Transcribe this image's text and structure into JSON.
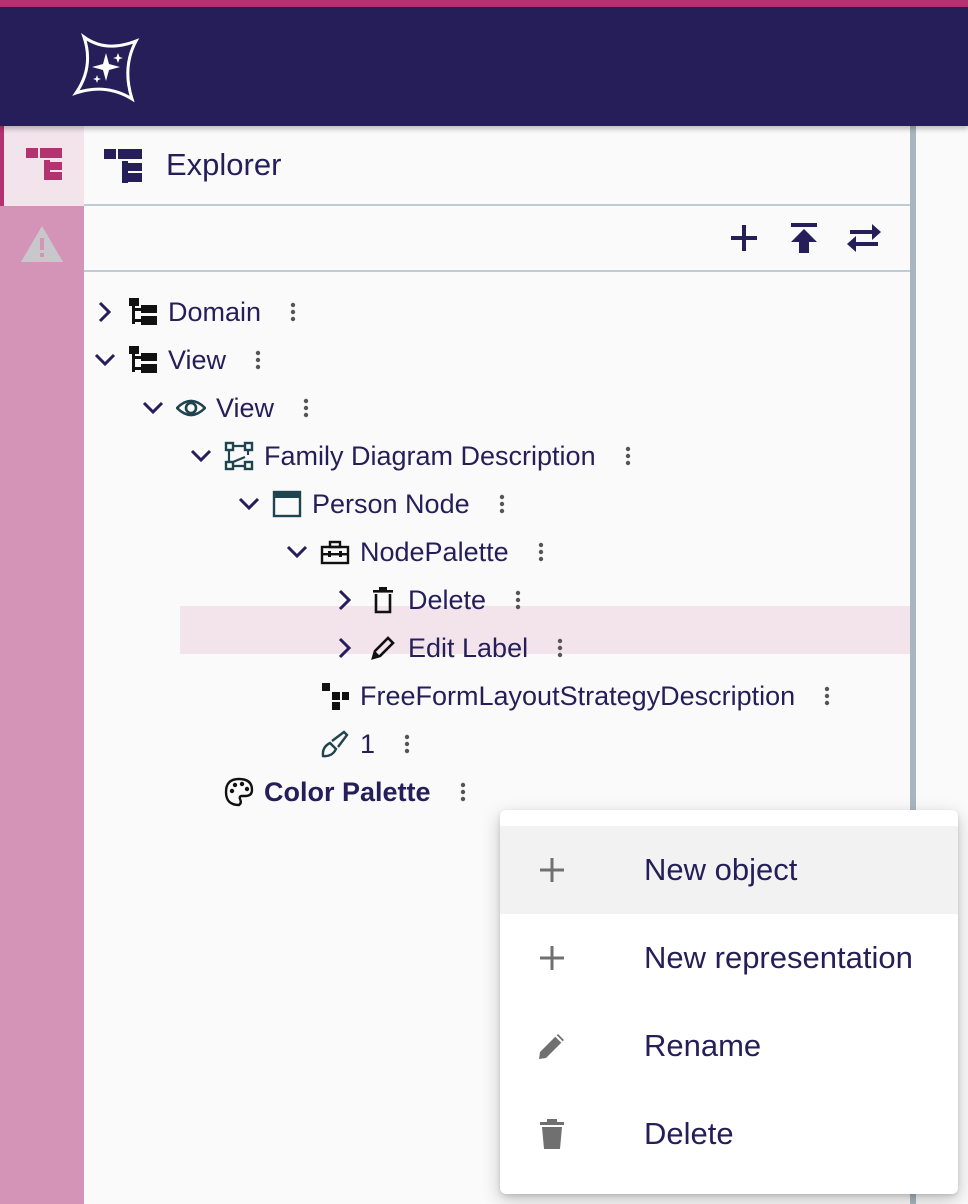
{
  "app": {
    "accent": "#b4326f",
    "header_bg": "#261e58",
    "rail_bg": "#d394b7",
    "logo_icon": "sirius-star-logo"
  },
  "rail": {
    "items": [
      {
        "icon": "explorer-tree-icon",
        "active": true
      },
      {
        "icon": "warning-icon",
        "active": false
      }
    ]
  },
  "explorer": {
    "title": "Explorer",
    "toolbar": [
      {
        "icon": "plus-icon"
      },
      {
        "icon": "upload-icon"
      },
      {
        "icon": "swap-arrows-icon"
      }
    ],
    "tree": [
      {
        "label": "Domain",
        "icon": "tree-icon",
        "expanded": false
      },
      {
        "label": "View",
        "icon": "tree-icon",
        "expanded": true
      },
      {
        "label": "View",
        "icon": "eye-icon",
        "expanded": true
      },
      {
        "label": "Family Diagram Description",
        "icon": "diagram-nodes-icon",
        "expanded": true
      },
      {
        "label": "Person Node",
        "icon": "node-box-icon",
        "expanded": true
      },
      {
        "label": "NodePalette",
        "icon": "toolbox-icon",
        "expanded": true
      },
      {
        "label": "Delete",
        "icon": "trash-outline-icon",
        "expanded": false
      },
      {
        "label": "Edit Label",
        "icon": "pencil-icon",
        "expanded": false
      },
      {
        "label": "FreeFormLayoutStrategyDescription",
        "icon": "layout-squares-icon",
        "expanded": null
      },
      {
        "label": "1",
        "icon": "brush-icon",
        "expanded": null
      },
      {
        "label": "Color Palette",
        "icon": "palette-icon",
        "expanded": null,
        "selected": true
      }
    ]
  },
  "context_menu": {
    "items": [
      {
        "label": "New object",
        "icon": "plus-icon"
      },
      {
        "label": "New representation",
        "icon": "plus-icon"
      },
      {
        "label": "Rename",
        "icon": "edit-pencil-icon"
      },
      {
        "label": "Delete",
        "icon": "trash-icon"
      }
    ]
  }
}
